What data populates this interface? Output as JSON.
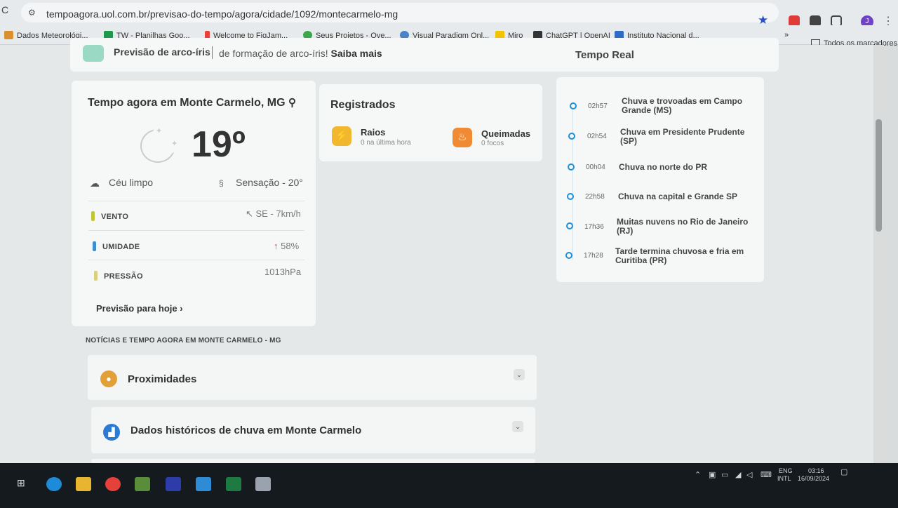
{
  "browser": {
    "url": "tempoagora.uol.com.br/previsao-do-tempo/agora/cidade/1092/montecarmelo-mg",
    "avatar_initial": "J",
    "bookmarks": [
      "Dados Meteorológi...",
      "TW - Planilhas Goo...",
      "Welcome to FigJam...",
      "Seus Projetos - Ove...",
      "Visual Paradigm Onl...",
      "Miro",
      "ChatGPT | OpenAI",
      "Instituto Nacional d..."
    ],
    "all_bookmarks": "Todos os marcadores"
  },
  "banner": {
    "title": "Previsão de arco-íris",
    "text": "de formação de arco-íris!",
    "link": "Saiba mais"
  },
  "weather": {
    "title": "Tempo agora em Monte Carmelo, MG",
    "temperature": "19º",
    "sky": "Céu limpo",
    "feels": "Sensação - 20°",
    "wind_label": "VENTO",
    "wind_value": "↖ SE - 7km/h",
    "humidity_label": "UMIDADE",
    "humidity_value": "58%",
    "pressure_label": "PRESSÃO",
    "pressure_value": "1013hPa",
    "forecast_link": "Previsão para hoje"
  },
  "registered": {
    "title": "Registrados",
    "raios_label": "Raios",
    "raios_sub": "0 na última hora",
    "queimadas_label": "Queimadas",
    "queimadas_sub": "0 focos"
  },
  "realtime": {
    "title": "Tempo Real",
    "items": [
      {
        "time": "02h57",
        "text": "Chuva e trovoadas em Campo Grande (MS)"
      },
      {
        "time": "02h54",
        "text": "Chuva em Presidente Prudente (SP)"
      },
      {
        "time": "00h04",
        "text": "Chuva no norte do PR"
      },
      {
        "time": "22h58",
        "text": "Chuva na capital e Grande SP"
      },
      {
        "time": "17h36",
        "text": "Muitas nuvens no Rio de Janeiro (RJ)"
      },
      {
        "time": "17h28",
        "text": "Tarde termina chuvosa e fria em Curitiba (PR)"
      }
    ]
  },
  "news": {
    "title": "NOTÍCIAS E TEMPO AGORA EM MONTE CARMELO - MG",
    "accordions": [
      "Proximidades",
      "Dados históricos de chuva em Monte Carmelo"
    ]
  },
  "taskbar": {
    "lang": "ENG",
    "layout": "INTL",
    "time": "03:16",
    "date": "16/09/2024"
  },
  "colors": {
    "accent_blue": "#1d8fd8",
    "raios_badge": "#f1b72f",
    "queimadas_badge": "#f08a33",
    "vento_tag": "#c2c53a",
    "umidade_tag": "#3e8fcf",
    "pressao_tag": "#d8d07a"
  }
}
